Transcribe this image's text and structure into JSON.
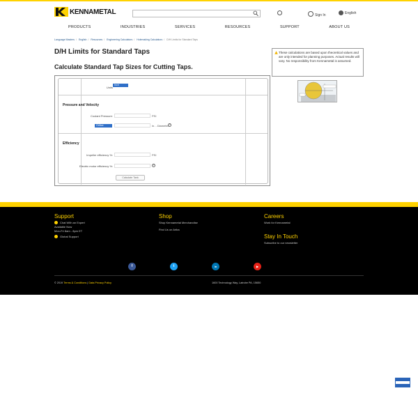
{
  "header": {
    "logo_text": "KENNAMETAL",
    "signin_label": "Sign In",
    "lang_label": "English",
    "search_placeholder": ""
  },
  "nav": {
    "items": [
      "PRODUCTS",
      "INDUSTRIES",
      "SERVICES",
      "RESOURCES",
      "SUPPORT",
      "ABOUT US"
    ]
  },
  "breadcrumb": {
    "items": [
      "Language Masters",
      "English",
      "Resources",
      "Engineering Calculators",
      "Holemaking Calculators"
    ],
    "current": "D/H Limits for Standard Taps"
  },
  "page": {
    "title": "D/H Limits for Standard Taps",
    "subtitle": "Calculate Standard Tap Sizes for Cutting Taps.",
    "notice": "These calculations are based upon theoretical values and are only intended for planning purposes. Actual results will vary. No responsibility from Kennametal is assumed."
  },
  "calculator": {
    "units_label": "Units",
    "units_value": "Inch",
    "section1_title": "Pressure and Velocity",
    "coolant_label": "Coolant Pressure:",
    "coolant_unit": "PSI",
    "orifice_value": "Orifice:",
    "orifice_unit": "in. - Diameter",
    "section2_title": "Efficiency",
    "impeller_label": "Impeller efficiency %:",
    "impeller_unit": "PSI",
    "motor_label": "Electric motor efficiency %:",
    "calc_button": "Calculate Tank"
  },
  "footer": {
    "support_title": "Support",
    "chat_label": "Chat With an Expert",
    "available": "Available Now",
    "hours": "Mon-Fri 8am - 8pm ET",
    "global_support": "Global Support",
    "shop_title": "Shop",
    "shop_link1": "Shop Kennametal Merchandise",
    "shop_link2": "Find Us on Ariba",
    "careers_title": "Careers",
    "careers_link": "Work for Kennametal",
    "touch_title": "Stay In Touch",
    "touch_link": "Subscribe to our newsletter",
    "copy_prefix": "© 2019 ",
    "terms": "Terms & Conditions",
    "privacy": "Data Privacy Policy",
    "address": "1600 Technology Way, Latrobe PA, 15650",
    "social_icons": [
      "facebook-icon",
      "twitter-icon",
      "linkedin-icon",
      "youtube-icon"
    ],
    "social_glyphs": [
      "f",
      "t",
      "in",
      "▶"
    ]
  },
  "colors": {
    "brand_yellow": "#ffd200",
    "link_blue": "#1a4f86",
    "select_blue": "#2f6fc8"
  }
}
